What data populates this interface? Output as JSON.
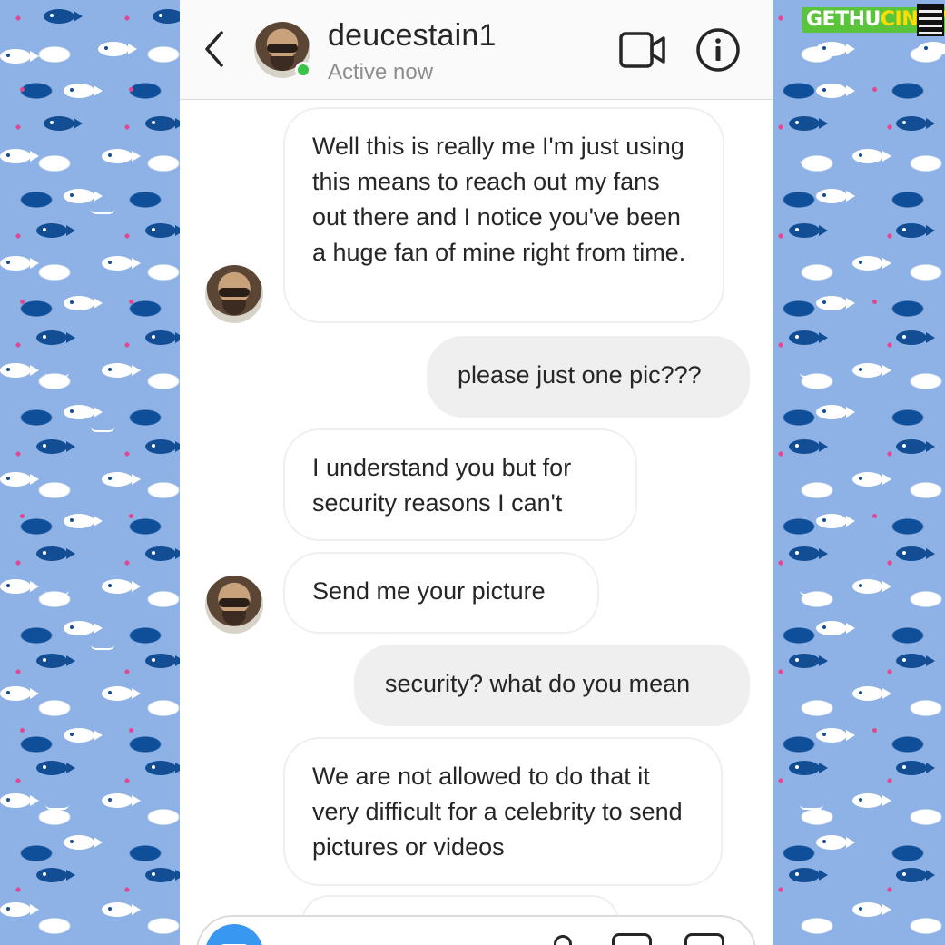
{
  "header": {
    "username": "deucestain1",
    "status": "Active now"
  },
  "icons": {
    "back": "chevron-left-icon",
    "video": "video-camera-icon",
    "info": "info-icon",
    "camera": "camera-icon",
    "mic": "microphone-icon",
    "gallery": "gallery-icon",
    "sticker": "sticker-icon"
  },
  "messages": [
    {
      "direction": "in",
      "text": "Well this is really me I'm just using this means to reach out my fans out there and I notice you've been a huge fan of mine right from time."
    },
    {
      "direction": "out",
      "text": "please just one pic???"
    },
    {
      "direction": "in",
      "text": "I understand you but for security reasons I can't"
    },
    {
      "direction": "in",
      "text": "Send me your picture"
    },
    {
      "direction": "out",
      "text": "security? what do you mean"
    },
    {
      "direction": "in",
      "text": "We are not allowed to do that it very difficult for a celebrity to send pictures or videos"
    }
  ],
  "watermark": {
    "part1": "GETHU",
    "part2": "CINEMA"
  },
  "colors": {
    "accent_blue": "#3897f0",
    "active_green": "#3ac34a",
    "incoming_bubble": "#ffffff",
    "outgoing_bubble": "#efefef",
    "background_pattern": "#8fb2e6"
  }
}
